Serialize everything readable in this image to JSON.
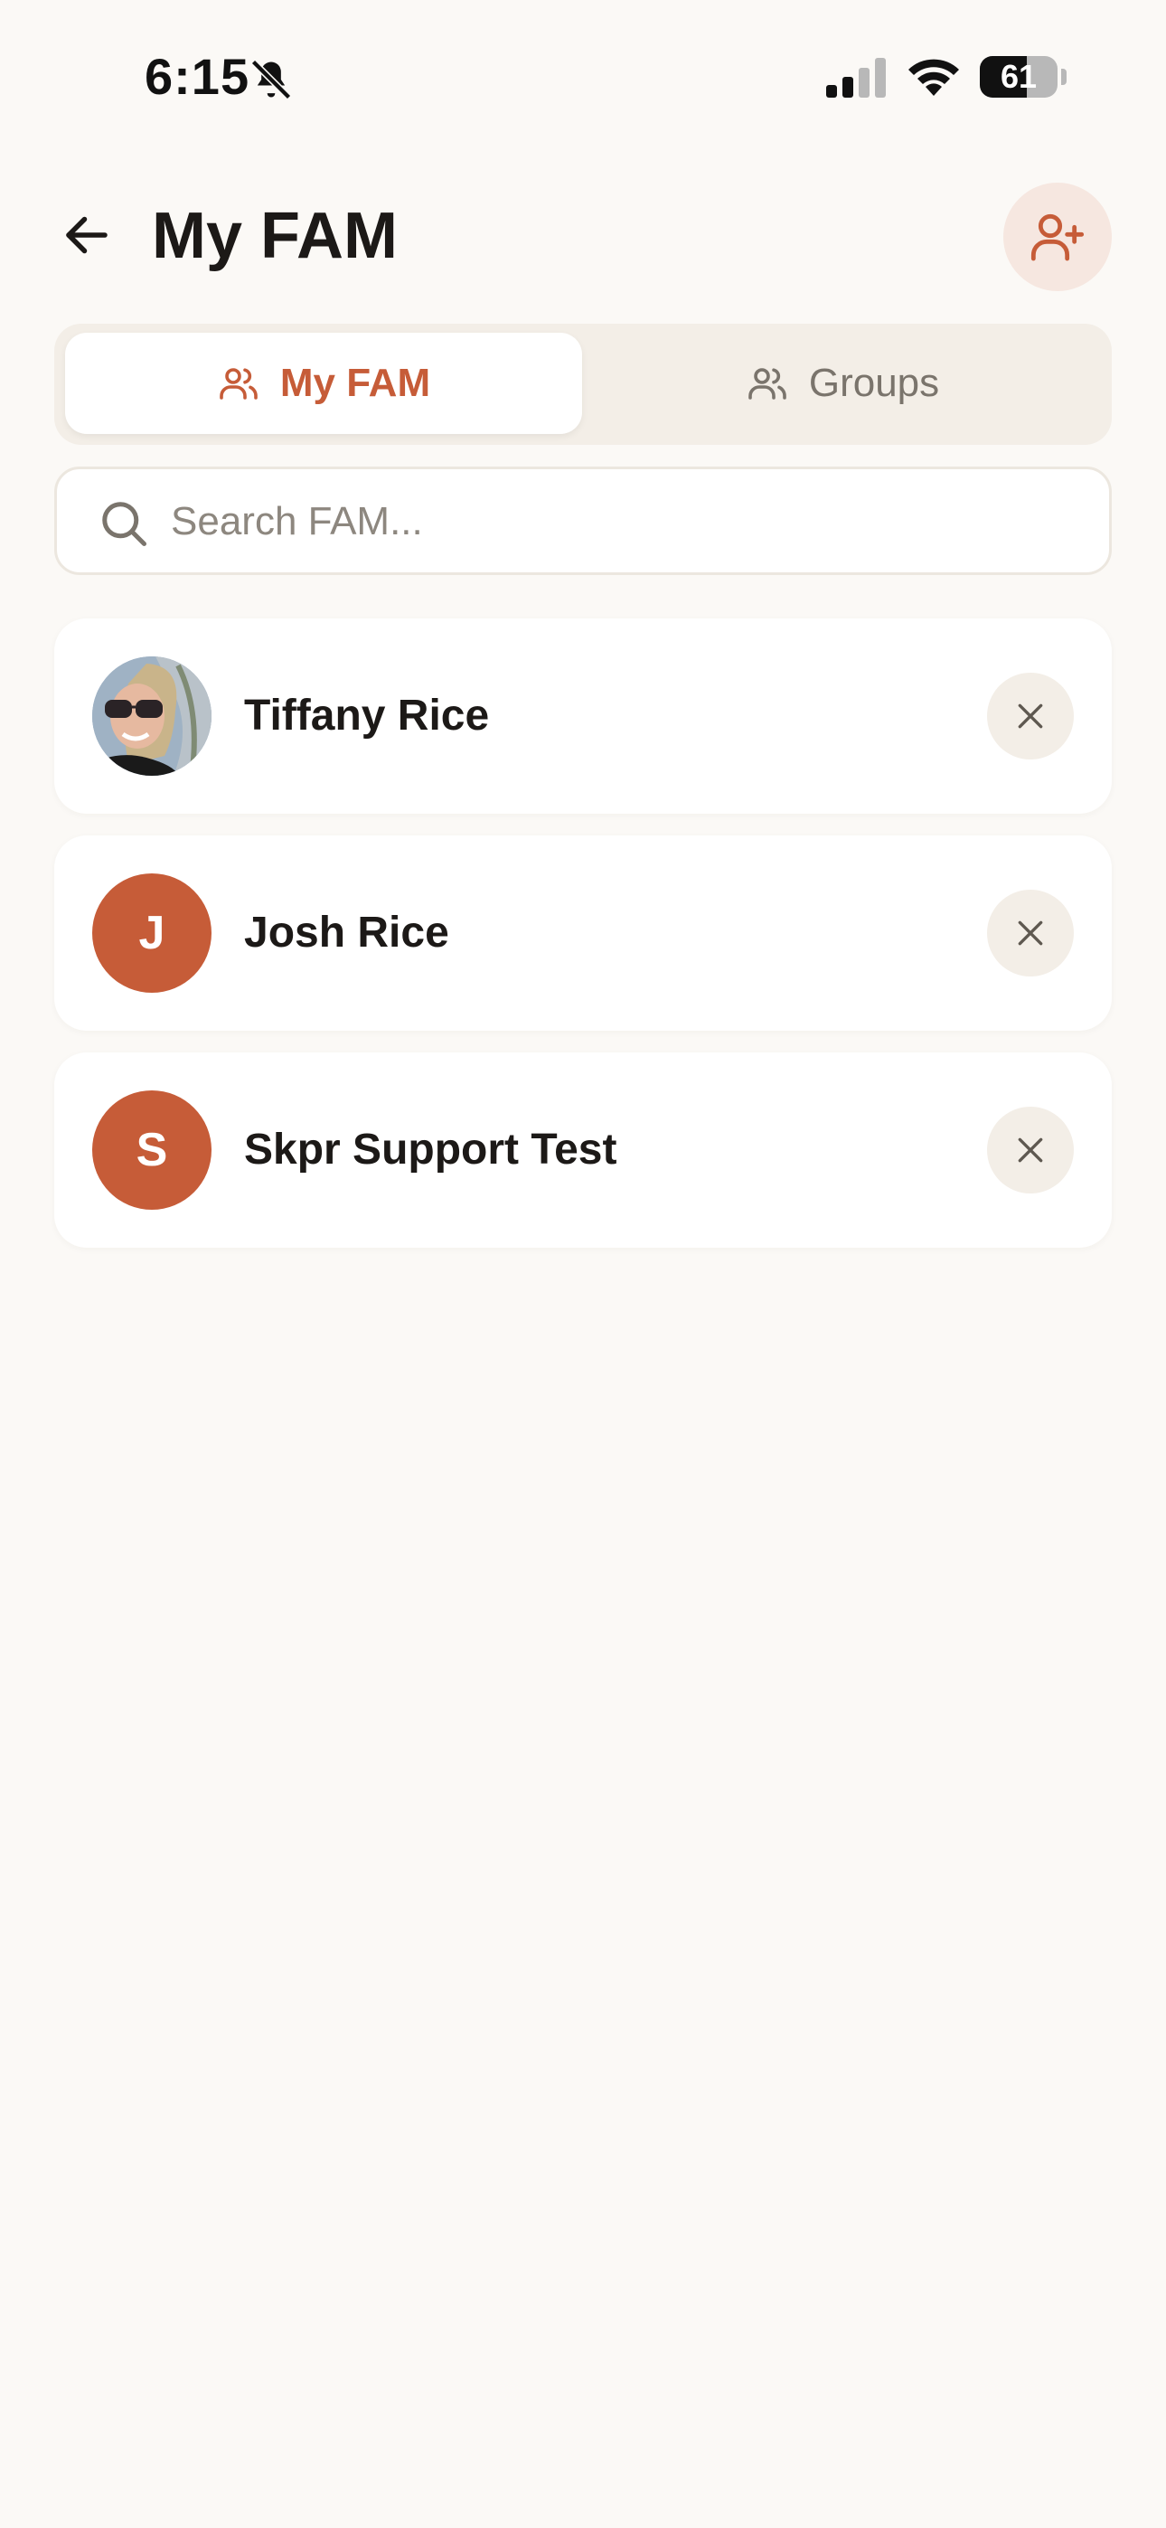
{
  "status_bar": {
    "time": "6:15",
    "battery": "61",
    "battery_level": 0.61,
    "icons": [
      "bell-slash-icon",
      "cellular-signal-icon",
      "wifi-icon",
      "battery-icon"
    ]
  },
  "header": {
    "title": "My FAM",
    "back_icon": "arrow-left-icon",
    "add_icon": "user-plus-icon"
  },
  "tabs": [
    {
      "label": "My FAM",
      "icon": "users-icon",
      "active": true
    },
    {
      "label": "Groups",
      "icon": "users-icon",
      "active": false
    }
  ],
  "search": {
    "placeholder": "Search FAM...",
    "value": "",
    "icon": "search-icon"
  },
  "members": [
    {
      "name": "Tiffany Rice",
      "avatar_type": "photo",
      "initial": ""
    },
    {
      "name": "Josh Rice",
      "avatar_type": "initial",
      "initial": "J"
    },
    {
      "name": "Skpr Support Test",
      "avatar_type": "initial",
      "initial": "S"
    }
  ],
  "colors": {
    "accent": "#c65c38",
    "background": "#fbf9f6",
    "segment_background": "#f3eee7",
    "add_button_background": "#f6e7e0"
  }
}
